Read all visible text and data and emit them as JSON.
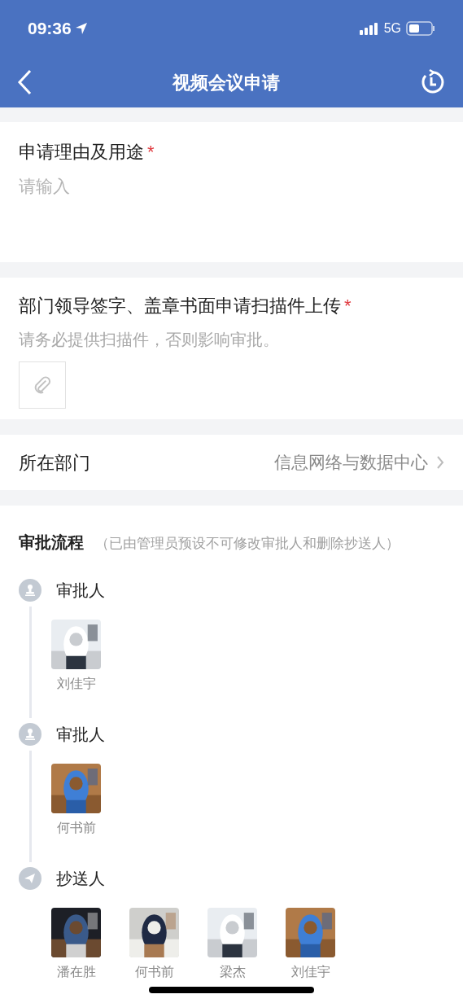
{
  "status_bar": {
    "time": "09:36",
    "network": "5G"
  },
  "nav": {
    "title": "视频会议申请"
  },
  "form": [
    {
      "kind": "textarea",
      "label": "申请理由及用途",
      "required_mark": "*",
      "placeholder": "请输入"
    },
    {
      "kind": "upload",
      "label": "部门领导签字、盖章书面申请扫描件上传",
      "required_mark": "*",
      "hint": "请务必提供扫描件，否则影响审批。"
    },
    {
      "kind": "select",
      "label": "所在部门",
      "value": "信息网络与数据中心"
    }
  ],
  "approval": {
    "title": "审批流程",
    "note": "（已由管理员预设不可修改审批人和删除抄送人）",
    "steps": [
      {
        "kind": "approver",
        "label": "审批人",
        "people": [
          {
            "name": "刘佳宇",
            "kind": "picture"
          }
        ]
      },
      {
        "kind": "approver",
        "label": "审批人",
        "people": [
          {
            "name": "何书前",
            "kind": "picture"
          }
        ]
      },
      {
        "kind": "cc",
        "label": "抄送人",
        "people": [
          {
            "name": "潘在胜",
            "kind": "picture"
          },
          {
            "name": "何书前",
            "kind": "picture"
          },
          {
            "name": "梁杰",
            "kind": "picture"
          },
          {
            "name": "刘佳宇",
            "kind": "picture"
          }
        ]
      }
    ]
  }
}
